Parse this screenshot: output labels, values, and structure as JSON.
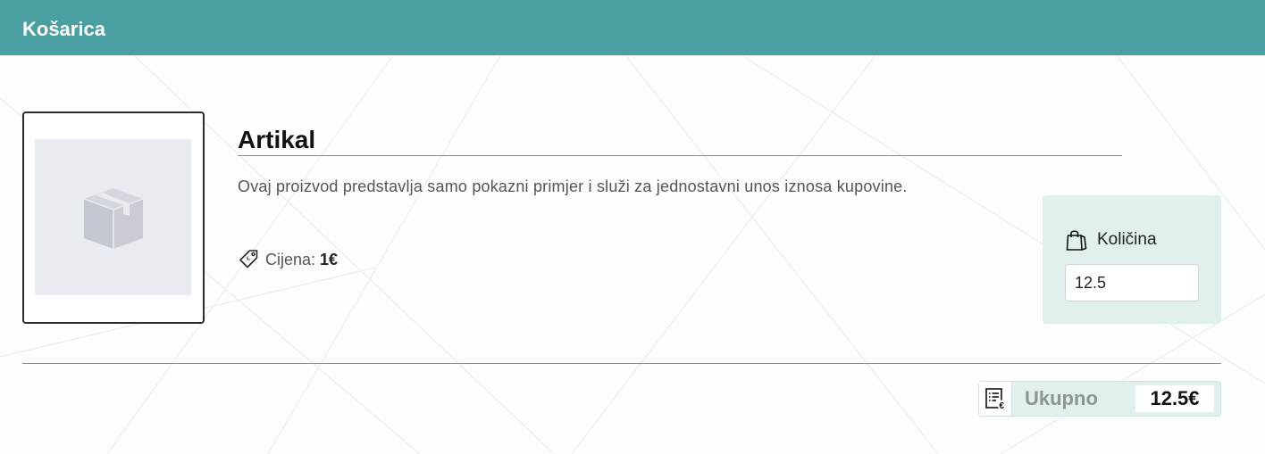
{
  "header": {
    "title": "Košarica",
    "background_color": "#4a9fa1"
  },
  "product": {
    "image_icon": "box-icon",
    "title": "Artikal",
    "description": "Ovaj proizvod predstavlja samo pokazni primjer i služi za jednostavni unos iznosa kupovine.",
    "price_icon": "price-tag-icon",
    "price_label": "Cijena:",
    "price_value": "1€"
  },
  "quantity": {
    "icon": "shopping-bag-icon",
    "label": "Količina",
    "value": "12.5",
    "panel_color": "#e1efef"
  },
  "total": {
    "icon": "receipt-euro-icon",
    "label": "Ukupno",
    "value": "12.5€"
  }
}
